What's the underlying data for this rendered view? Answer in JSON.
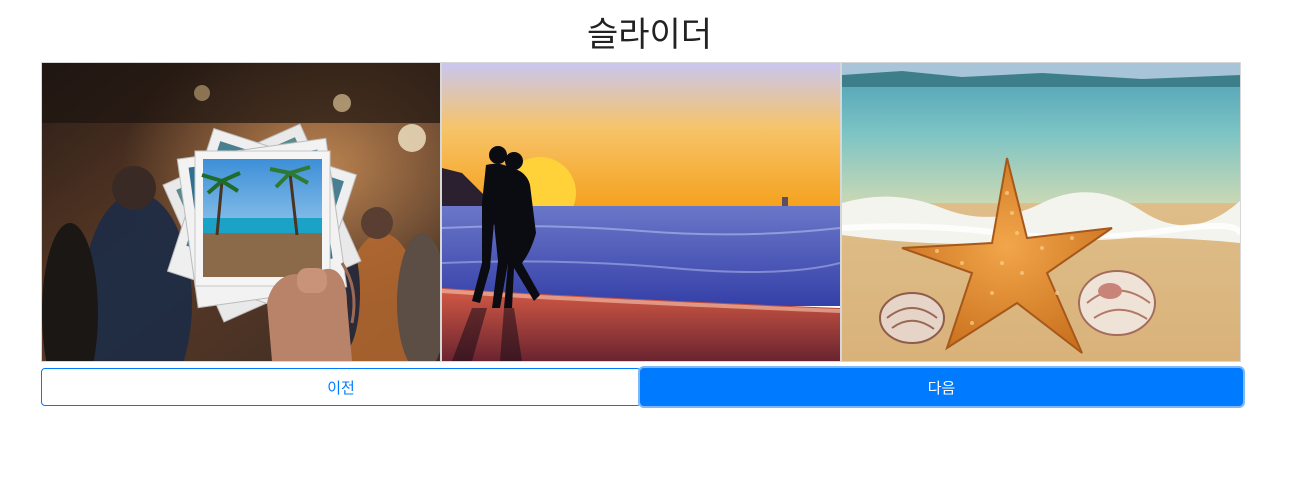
{
  "page": {
    "title": "슬라이더"
  },
  "slider": {
    "slides": [
      {
        "image": "hand-holding-polaroid-photos-of-palm-beach"
      },
      {
        "image": "couple-silhouette-at-sunset-beach"
      },
      {
        "image": "starfish-and-seashells-on-sand-beach"
      }
    ]
  },
  "controls": {
    "prev_label": "이전",
    "next_label": "다음"
  },
  "colors": {
    "primary": "#007bff",
    "text": "#222222"
  }
}
